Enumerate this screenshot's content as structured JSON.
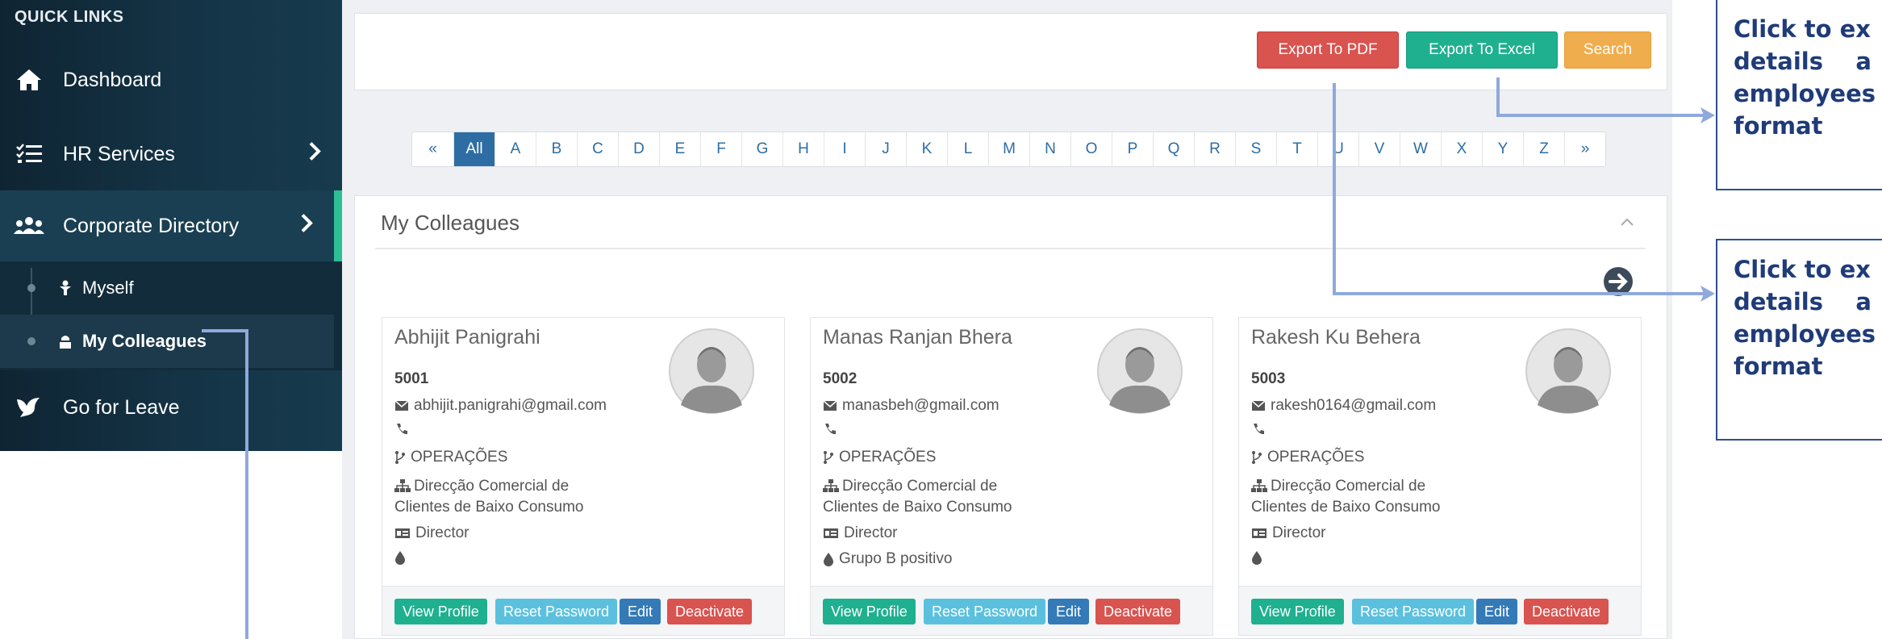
{
  "sidebar": {
    "title": "QUICK LINKS",
    "items": [
      {
        "label": "Dashboard"
      },
      {
        "label": "HR Services"
      },
      {
        "label": "Corporate Directory"
      },
      {
        "label": "Go for Leave"
      }
    ],
    "subitems": [
      {
        "label": "Myself"
      },
      {
        "label": "My Colleagues"
      }
    ]
  },
  "toolbar": {
    "export_pdf": "Export To PDF",
    "export_excel": "Export To Excel",
    "search": "Search"
  },
  "alphabet": [
    "«",
    "All",
    "A",
    "B",
    "C",
    "D",
    "E",
    "F",
    "G",
    "H",
    "I",
    "J",
    "K",
    "L",
    "M",
    "N",
    "O",
    "P",
    "Q",
    "R",
    "S",
    "T",
    "U",
    "V",
    "W",
    "X",
    "Y",
    "Z",
    "»"
  ],
  "colleagues": {
    "title": "My Colleagues",
    "cards": [
      {
        "name": "Abhijit Panigrahi",
        "id": "5001",
        "email": "abhijit.panigrahi@gmail.com",
        "phone": "",
        "area": "OPERAÇÕES",
        "department": "Direcção Comercial de Clientes de Baixo Consumo",
        "role": "Director",
        "blood": ""
      },
      {
        "name": "Manas Ranjan Bhera",
        "id": "5002",
        "email": "manasbeh@gmail.com",
        "phone": "",
        "area": "OPERAÇÕES",
        "department": "Direcção Comercial de Clientes de Baixo Consumo",
        "role": "Director",
        "blood": "Grupo B positivo"
      },
      {
        "name": "Rakesh Ku Behera",
        "id": "5003",
        "email": "rakesh0164@gmail.com",
        "phone": "",
        "area": "OPERAÇÕES",
        "department": "Direcção Comercial de Clientes de Baixo Consumo",
        "role": "Director",
        "blood": ""
      }
    ],
    "actions": {
      "view": "View Profile",
      "reset": "Reset Password",
      "edit": "Edit",
      "deactivate": "Deactivate"
    }
  },
  "annotations": {
    "note1": "Click to ex\ndetails    a\nemployees \nformat",
    "note2": "Click to ex\ndetails    a\nemployees \nformat"
  },
  "colors": {
    "sidebar_bg": "#143446",
    "accent_green": "#2bbf95",
    "pdf": "#d9534f",
    "excel": "#1fb08f",
    "search": "#f0ad4e",
    "connector": "#8fa9dc",
    "annotation_text": "#1f3b78"
  }
}
